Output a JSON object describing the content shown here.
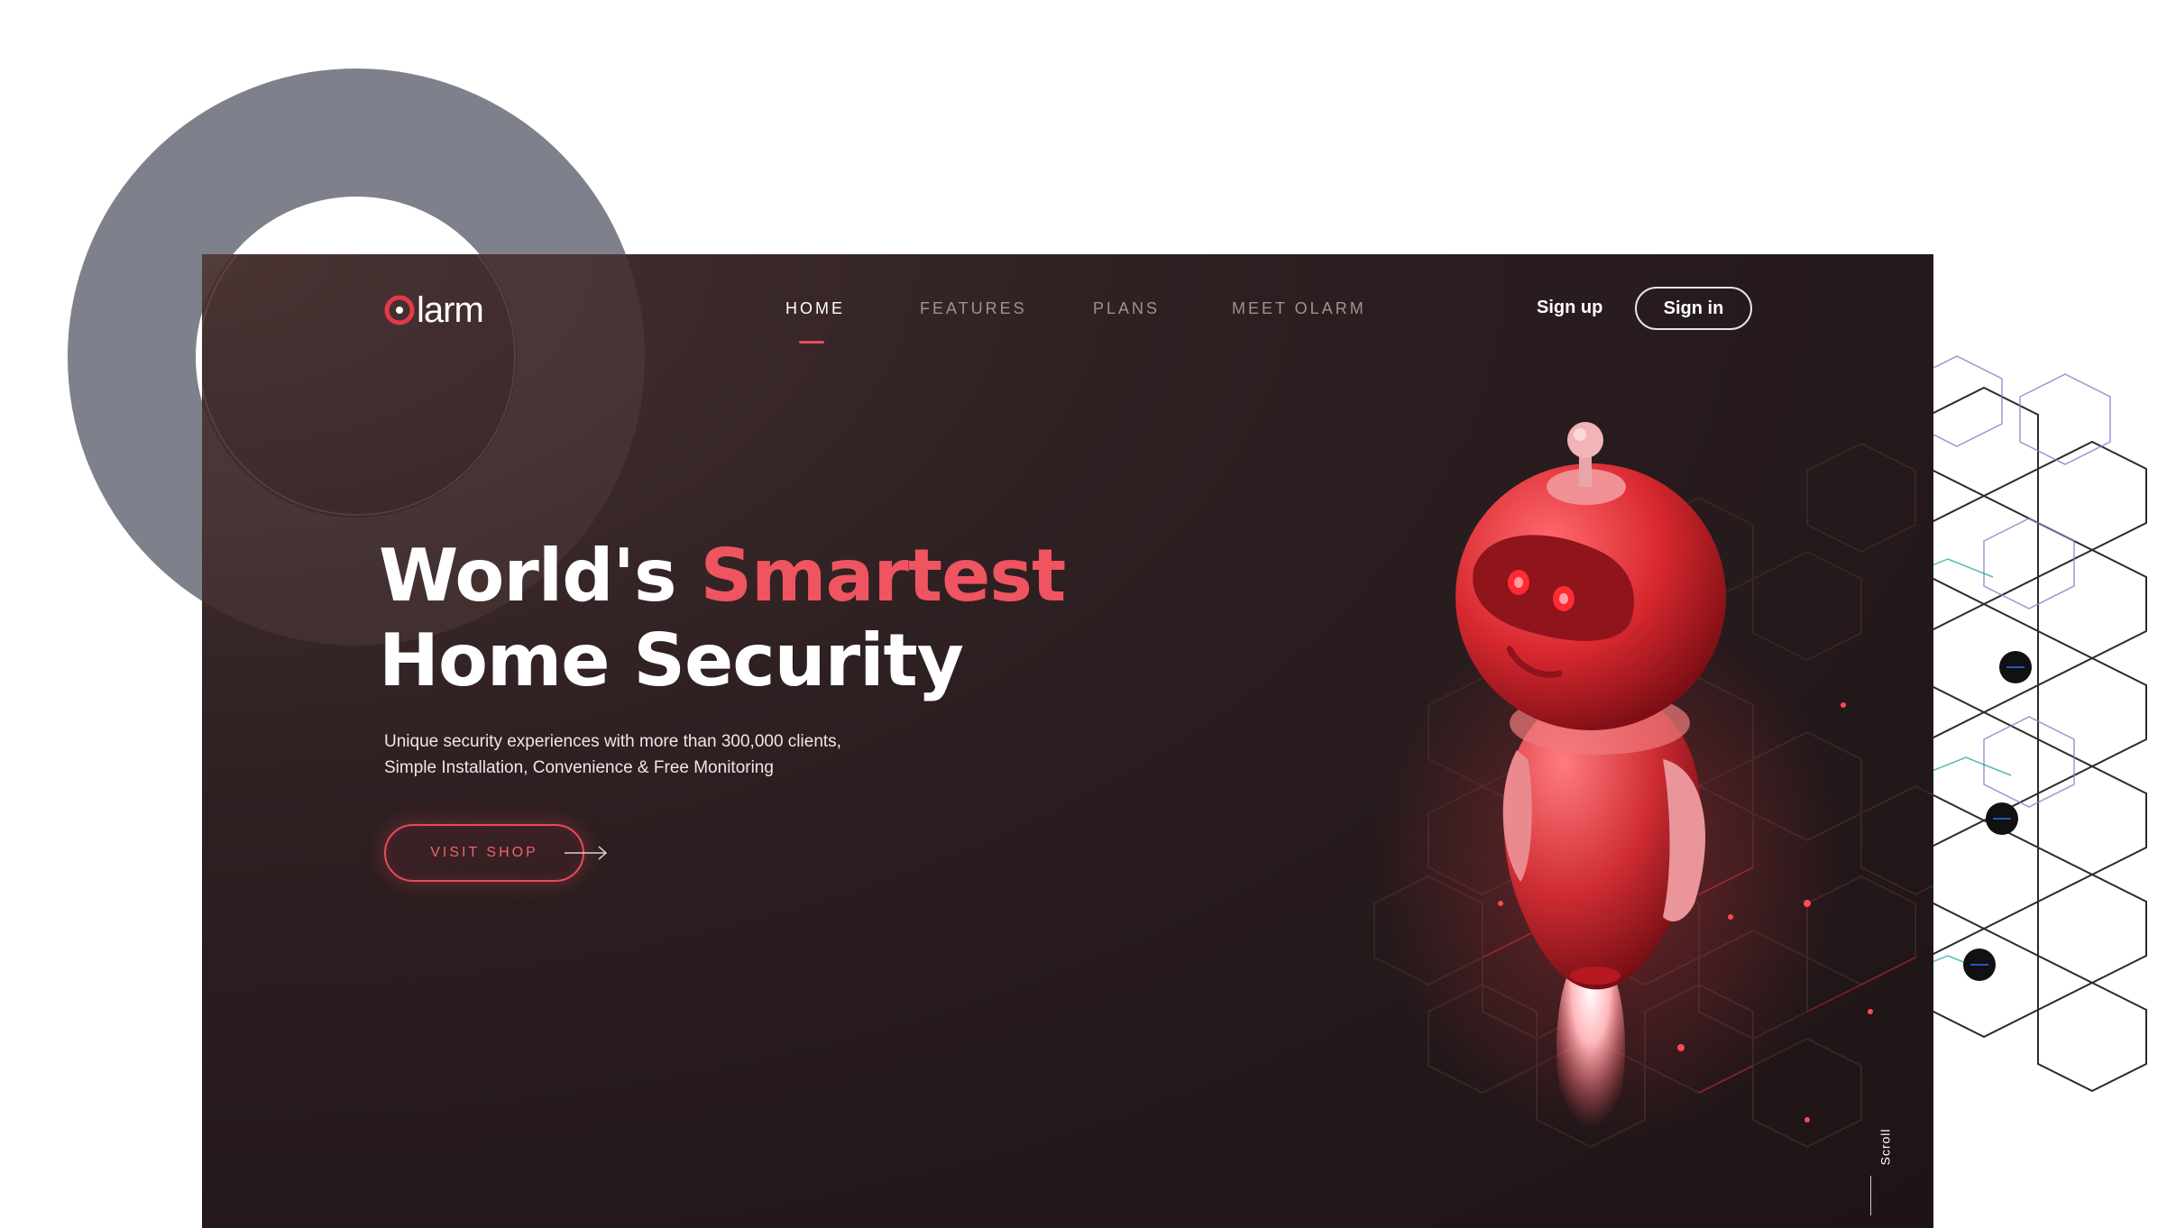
{
  "brand": {
    "logo_text": "larm",
    "accent_color": "#e84c5b",
    "background_color": "#2a1d1f"
  },
  "nav": {
    "items": [
      {
        "label": "HOME",
        "active": true
      },
      {
        "label": "FEATURES",
        "active": false
      },
      {
        "label": "PLANS",
        "active": false
      },
      {
        "label": "MEET OLARM",
        "active": false
      }
    ]
  },
  "auth": {
    "signup_label": "Sign up",
    "signin_label": "Sign in"
  },
  "hero": {
    "title_line1_part1": "World's",
    "title_line1_part2": "Smartest",
    "title_line2": "Home Security",
    "subtitle_line1": "Unique security experiences with more than 300,000 clients,",
    "subtitle_line2": "Simple Installation, Convenience & Free Monitoring",
    "cta_label": "VISIT SHOP"
  },
  "scroll": {
    "label": "Scroll"
  },
  "icons": {
    "logo_mark": "target-circle-icon",
    "cta_arrow": "arrow-right-icon",
    "illustration": "robot-illustration"
  }
}
